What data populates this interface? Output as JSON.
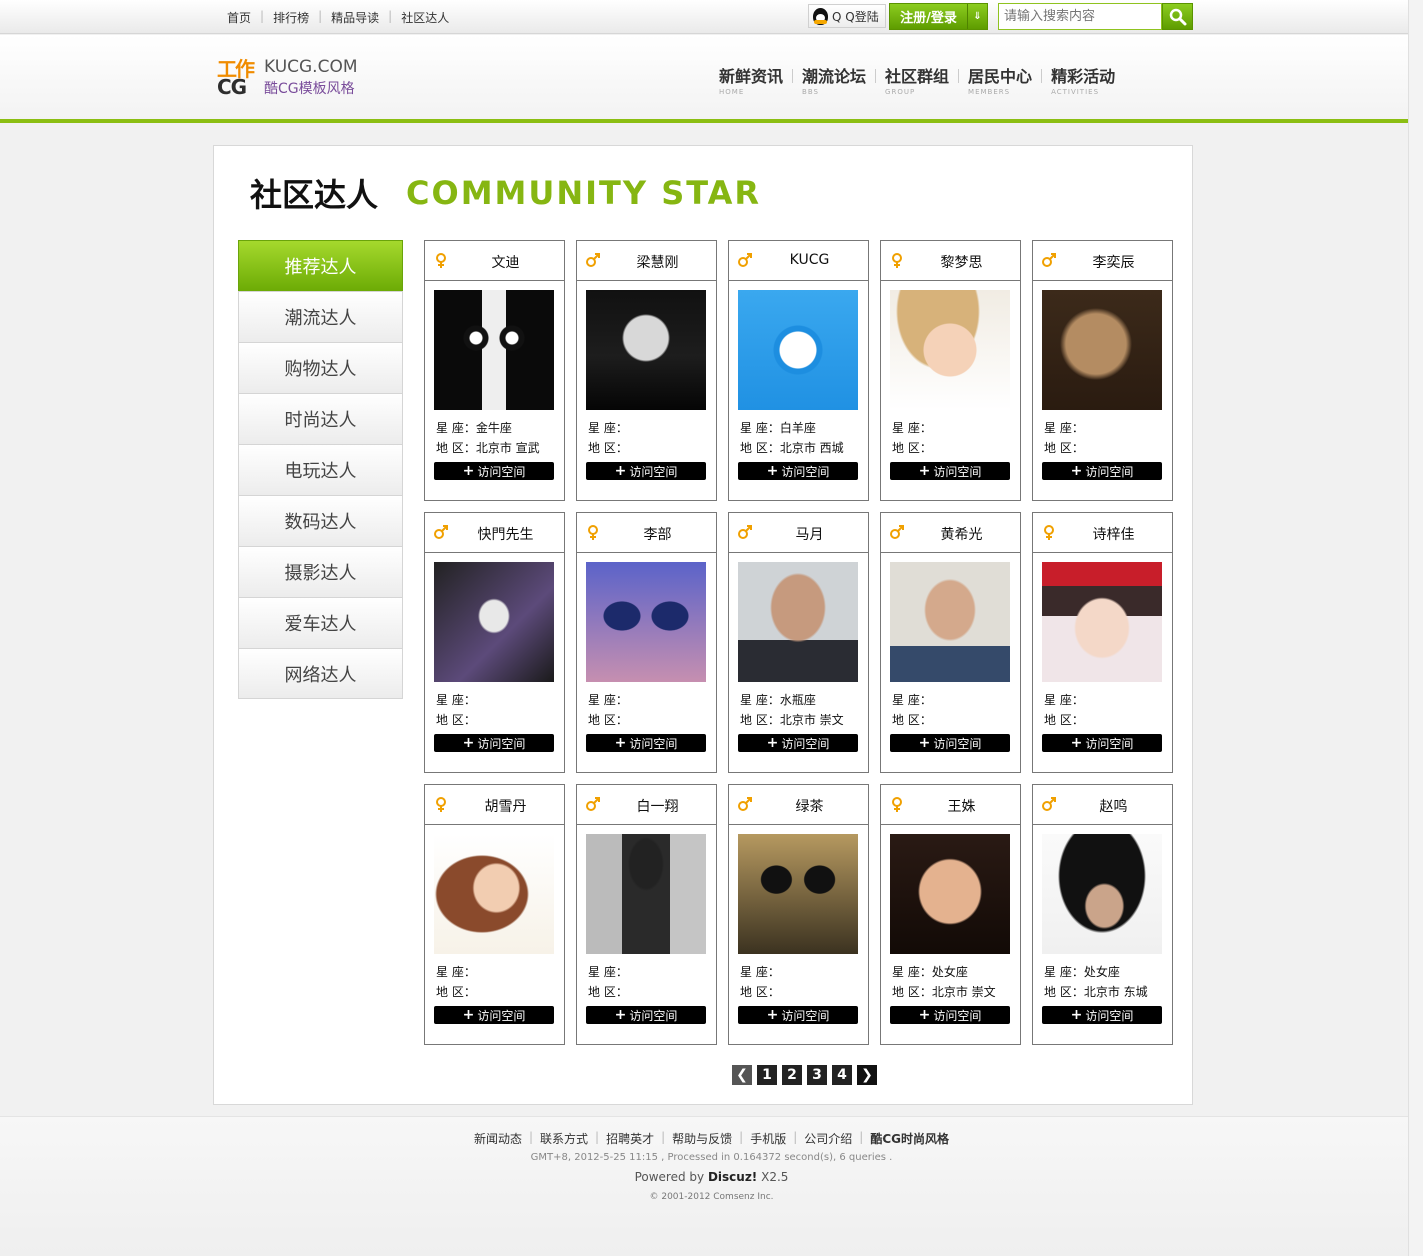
{
  "topbar": {
    "links": [
      "首页",
      "排行榜",
      "精品导读",
      "社区达人"
    ],
    "qq_login": "Q Q登陆",
    "register_login": "注册/登录",
    "search_placeholder": "请输入搜索内容"
  },
  "logo": {
    "line1": "KUCG.COM",
    "line2": "酷CG模板风格",
    "mark_top": "工作",
    "mark_bottom": "CG"
  },
  "nav": [
    {
      "zh": "新鲜资讯",
      "en": "HOME"
    },
    {
      "zh": "潮流论坛",
      "en": "BBS"
    },
    {
      "zh": "社区群组",
      "en": "GROUP"
    },
    {
      "zh": "居民中心",
      "en": "MEMBERS"
    },
    {
      "zh": "精彩活动",
      "en": "ACTIVITIES"
    }
  ],
  "page": {
    "title_zh": "社区达人",
    "title_en": "COMMUNITY STAR"
  },
  "categories": [
    "推荐达人",
    "潮流达人",
    "购物达人",
    "时尚达人",
    "电玩达人",
    "数码达人",
    "摄影达人",
    "爱车达人",
    "网络达人"
  ],
  "labels": {
    "constellation": "星  座：",
    "region": "地  区：",
    "visit": "访问空间"
  },
  "members": [
    {
      "name": "文迪",
      "gender": "female",
      "constellation": "金牛座",
      "region": "北京市 宣武",
      "photo": "bw-star-face-icon"
    },
    {
      "name": "梁慧刚",
      "gender": "male",
      "constellation": "",
      "region": "",
      "photo": "bw-covered-face-icon"
    },
    {
      "name": "KUCG",
      "gender": "male",
      "constellation": "白羊座",
      "region": "北京市 西城",
      "photo": "kucg-winged-logo-icon"
    },
    {
      "name": "黎梦思",
      "gender": "female",
      "constellation": "",
      "region": "",
      "photo": "girl-straw-hat-icon"
    },
    {
      "name": "李奕辰",
      "gender": "male",
      "constellation": "",
      "region": "",
      "photo": "sepia-portrait-icon"
    },
    {
      "name": "快門先生",
      "gender": "male",
      "constellation": "",
      "region": "",
      "photo": "white-glasses-icon"
    },
    {
      "name": "李部",
      "gender": "female",
      "constellation": "",
      "region": "",
      "photo": "sunglasses-selfie-icon"
    },
    {
      "name": "马月",
      "gender": "male",
      "constellation": "水瓶座",
      "region": "北京市 崇文",
      "photo": "suit-portrait-icon"
    },
    {
      "name": "黄希光",
      "gender": "male",
      "constellation": "",
      "region": "",
      "photo": "glasses-man-icon"
    },
    {
      "name": "诗梓佳",
      "gender": "female",
      "constellation": "",
      "region": "",
      "photo": "headband-girl-icon"
    },
    {
      "name": "胡雪丹",
      "gender": "female",
      "constellation": "",
      "region": "",
      "photo": "curly-hair-woman-icon"
    },
    {
      "name": "白一翔",
      "gender": "male",
      "constellation": "",
      "region": "",
      "photo": "bw-fashion-pose-icon"
    },
    {
      "name": "绿茶",
      "gender": "male",
      "constellation": "",
      "region": "",
      "photo": "goggles-man-icon"
    },
    {
      "name": "王姝",
      "gender": "female",
      "constellation": "处女座",
      "region": "北京市 崇文",
      "photo": "smiling-woman-icon"
    },
    {
      "name": "赵鸣",
      "gender": "male",
      "constellation": "处女座",
      "region": "北京市 东城",
      "photo": "spiky-hair-icon"
    }
  ],
  "pager": {
    "pages": [
      "1",
      "2",
      "3",
      "4"
    ]
  },
  "footer": {
    "links": [
      "新闻动态",
      "联系方式",
      "招聘英才",
      "帮助与反馈",
      "手机版",
      "公司介绍"
    ],
    "brand": "酷CG时尚风格",
    "stats": "GMT+8, 2012-5-25 11:15 , Processed in 0.164372 second(s), 6 queries .",
    "powered_prefix": "Powered by ",
    "powered_name": "Discuz!",
    "powered_version": " X2.5",
    "copyright": "© 2001-2012 Comsenz Inc."
  },
  "colors": {
    "accent_green": "#8bbe12",
    "gender_icon": "#f0a000",
    "title_en": "#86b612"
  }
}
